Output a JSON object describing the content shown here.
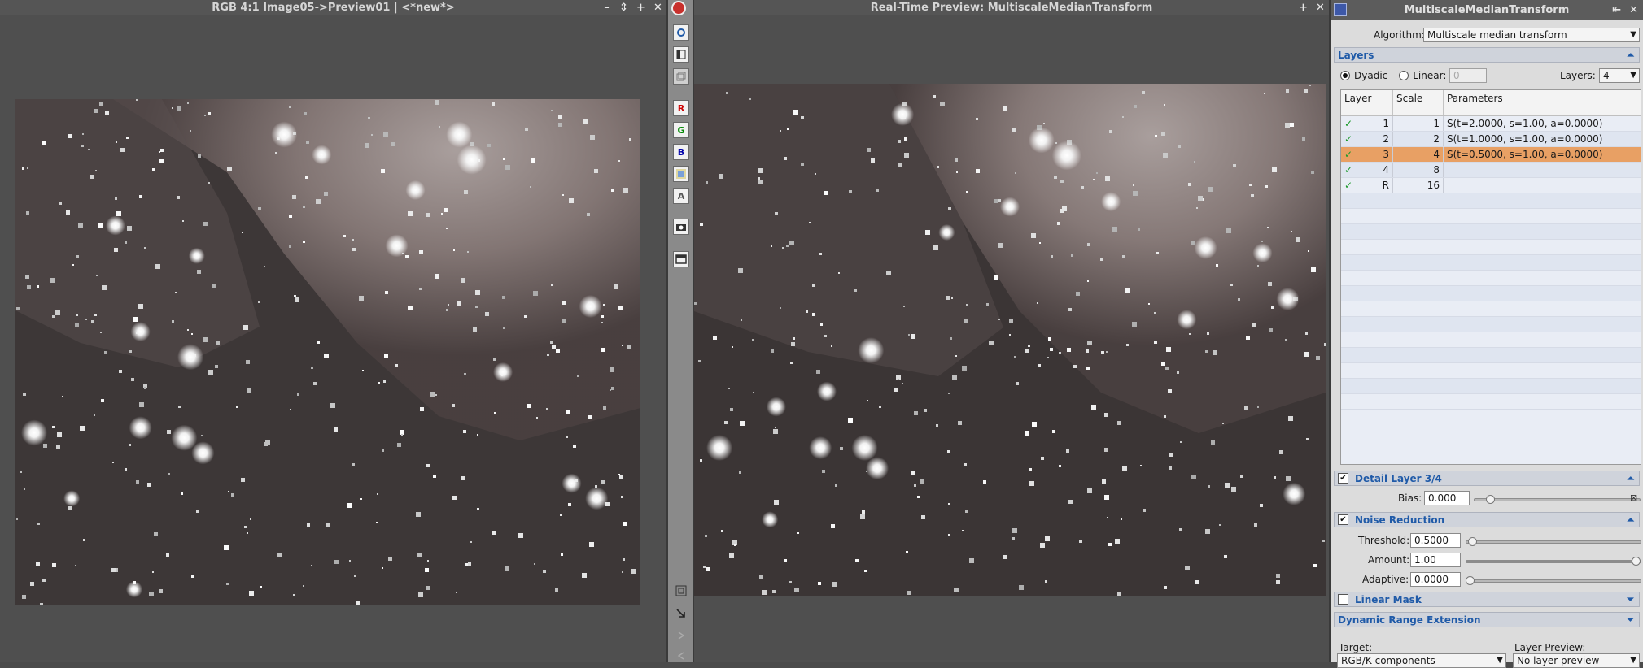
{
  "left_window": {
    "title": "RGB 4:1 Image05->Preview01 | <*new*>",
    "controls": [
      "–",
      "⇕",
      "+",
      "✕"
    ]
  },
  "preview_window": {
    "title": "Real-Time Preview: MultiscaleMedianTransform",
    "controls": [
      "+",
      "✕"
    ]
  },
  "toolbar": {
    "buttons": [
      "circle-icon",
      "panel-icon",
      "stack-icon",
      "R",
      "G",
      "B",
      "rgb-icon",
      "A",
      "camera-icon",
      "window-icon",
      "frame-icon",
      "arrow-icon",
      "next-icon",
      "prev-icon"
    ]
  },
  "panel": {
    "title": "MultiscaleMedianTransform",
    "controls": [
      "⇤",
      "✕"
    ],
    "algorithm_label": "Algorithm:",
    "algorithm_value": "Multiscale median transform",
    "layers_section": "Layers",
    "dyadic_label": "Dyadic",
    "linear_label": "Linear:",
    "linear_value": "0",
    "layers_label": "Layers:",
    "layers_value": "4",
    "columns": [
      "Layer",
      "Scale",
      "Parameters"
    ],
    "rows": [
      {
        "layer": "1",
        "scale": "1",
        "params": "S(t=2.0000, s=1.00, a=0.0000)",
        "enabled": true
      },
      {
        "layer": "2",
        "scale": "2",
        "params": "S(t=1.0000, s=1.00, a=0.0000)",
        "enabled": true
      },
      {
        "layer": "3",
        "scale": "4",
        "params": "S(t=0.5000, s=1.00, a=0.0000)",
        "enabled": true,
        "selected": true
      },
      {
        "layer": "4",
        "scale": "8",
        "params": "",
        "enabled": true
      },
      {
        "layer": "R",
        "scale": "16",
        "params": "",
        "enabled": true
      }
    ],
    "detail_section": "Detail Layer 3/4",
    "bias_label": "Bias:",
    "bias_value": "0.000",
    "noise_section": "Noise Reduction",
    "threshold_label": "Threshold:",
    "threshold_value": "0.5000",
    "amount_label": "Amount:",
    "amount_value": "1.00",
    "adaptive_label": "Adaptive:",
    "adaptive_value": "0.0000",
    "linear_mask_section": "Linear Mask",
    "dre_section": "Dynamic Range Extension",
    "target_label": "Target:",
    "target_value": "RGB/K components",
    "layer_preview_label": "Layer Preview:",
    "layer_preview_value": "No layer preview"
  },
  "colors": {
    "accent": "#1f5aa8",
    "selected_row": "#e8a064",
    "check": "#1b9a2a"
  }
}
